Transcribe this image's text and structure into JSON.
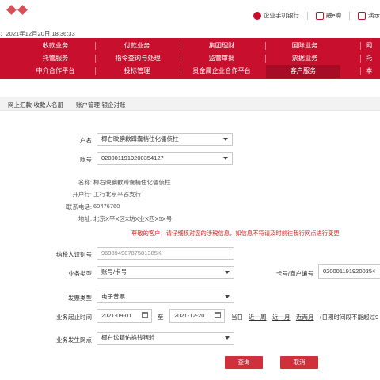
{
  "header": {
    "datetime": "：2021年12月20日 18:36:33",
    "links": [
      {
        "label": "企业手机银行",
        "icon": "mobile-bank-icon"
      },
      {
        "label": "融e购",
        "icon": "cart-icon"
      },
      {
        "label": "演示",
        "icon": "demo-icon"
      }
    ]
  },
  "nav": {
    "row1": [
      "收款业务",
      "付款业务",
      "集团理财",
      "国际业务",
      "网"
    ],
    "row2": [
      "托管服务",
      "指令查询与处理",
      "监管审批",
      "票据业务",
      "托"
    ],
    "row3": [
      "中介合作平台",
      "投标管理",
      "贵金属企业合作平台",
      "客户服务",
      "本"
    ],
    "active": "客户服务"
  },
  "breadcrumb": {
    "first": "网上汇款-收款人名册",
    "second": "账户管理-银企对账"
  },
  "form": {
    "account_name_label": "户名",
    "account_name_value": "椰右映腆歉蹲囊梢住化儡侦柱",
    "account_no_label": "账号",
    "account_no_value": "0200011919200354127",
    "info_name_label": "名称:",
    "info_name_value": "椰右映腆歉蹲囊梢住化儡侦柱",
    "info_bank_label": "开户行:",
    "info_bank_value": "工行北京平谷支行",
    "info_phone_label": "联系电话:",
    "info_phone_value": "60476760",
    "info_addr_label": "地址:",
    "info_addr_value": "北京X平X区X坊X业X西X5X号",
    "notice": "尊敬的客户，请仔细核对您的涉税信息，如信息不符请及时前往我行网点进行变更",
    "taxpayer_label": "纳税人识别号",
    "taxpayer_value": "96989498787581385K",
    "biz_type_label": "业务类型",
    "biz_type_value": "账号/卡号",
    "card_label": "卡号/商户编号",
    "card_value": "0200011919200354",
    "invoice_label": "发票类型",
    "invoice_value": "电子普票",
    "date_label": "业务起止时间",
    "date_start": "2021-09-01",
    "date_to": "至",
    "date_end": "2021-12-20",
    "quick": [
      "当日",
      "近一周",
      "近一月",
      "近两月"
    ],
    "hint": "(日期时间段不能超过9",
    "branch_label": "业务发生网点",
    "branch_value": "椰右讼籍佑掐钱猪验"
  },
  "buttons": {
    "query": "查询",
    "cancel": "取消"
  },
  "colors": {
    "brand_red": "#c8102e",
    "button_red": "#d0303a",
    "notice_red": "#e02020"
  }
}
